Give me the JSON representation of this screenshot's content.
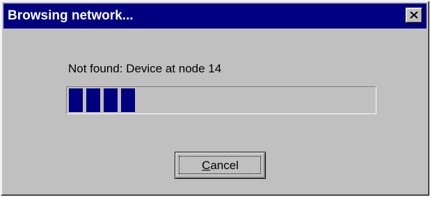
{
  "dialog": {
    "title": "Browsing network...",
    "close_icon": "close-x-icon",
    "status_text": "Not found: Device at node 14",
    "progress": {
      "filled_blocks": 4,
      "block_color": "#000080"
    },
    "cancel_button": {
      "accel": "C",
      "rest": "ancel"
    }
  },
  "colors": {
    "titlebar": "#000080",
    "face": "#c0c0c0",
    "title_text": "#ffffff"
  }
}
